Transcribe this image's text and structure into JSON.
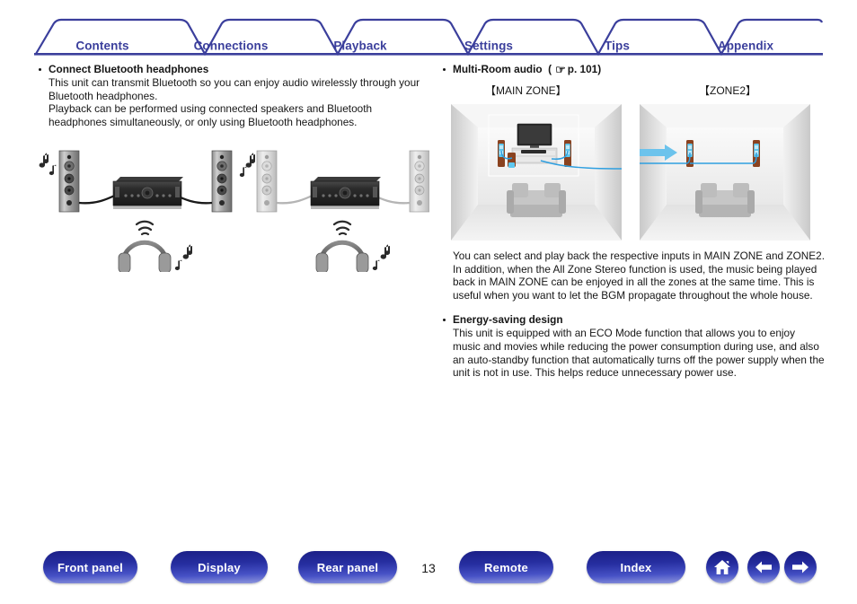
{
  "tabs": [
    {
      "label": "Contents"
    },
    {
      "label": "Connections"
    },
    {
      "label": "Playback"
    },
    {
      "label": "Settings"
    },
    {
      "label": "Tips"
    },
    {
      "label": "Appendix"
    }
  ],
  "colors": {
    "tab_text": "#3b3f9c",
    "tab_line": "#3b3f9c",
    "button_blue": "#262ea0",
    "cable_blue": "#2e9fe0",
    "body_text": "#161616"
  },
  "left_column": {
    "heading": "Connect Bluetooth headphones",
    "paragraphs": [
      "This unit can transmit Bluetooth so you can enjoy audio wirelessly through your Bluetooth headphones.",
      "Playback can be performed using connected speakers and Bluetooth headphones simultaneously, or only using Bluetooth headphones."
    ],
    "diagram": {
      "name": "bluetooth-headphones-diagram",
      "caption_a": "speakers and receiver active with Bluetooth headphones",
      "caption_b": "speakers muted, Bluetooth headphones only"
    }
  },
  "right_column": {
    "heading": "Multi-Room audio",
    "reference_icon": "☞",
    "reference_page": "p. 101",
    "zone_labels": {
      "main": "【MAIN ZONE】",
      "zone2": "【ZONE2】"
    },
    "paragraphs": [
      "You can select and play back the respective inputs in MAIN ZONE and ZONE2.",
      "In addition, when the All Zone Stereo function is used, the music being played back in MAIN ZONE can be enjoyed in all the zones at the same time. This is useful when you want to let the BGM propagate throughout the whole house."
    ],
    "section2": {
      "heading": "Energy-saving design",
      "paragraphs": [
        "This unit is equipped with an ECO Mode function that allows you to enjoy music and movies while reducing the power consumption during use, and also an auto-standby function that automatically turns off the power supply when the unit is not in use. This helps reduce unnecessary power use."
      ]
    }
  },
  "footer": {
    "buttons": [
      {
        "label": "Front panel"
      },
      {
        "label": "Display"
      },
      {
        "label": "Rear panel"
      },
      {
        "label": "Remote"
      },
      {
        "label": "Index"
      }
    ],
    "page_number": "13",
    "icon_buttons": [
      {
        "name": "home-icon"
      },
      {
        "name": "arrow-left-icon"
      },
      {
        "name": "arrow-right-icon"
      }
    ]
  }
}
